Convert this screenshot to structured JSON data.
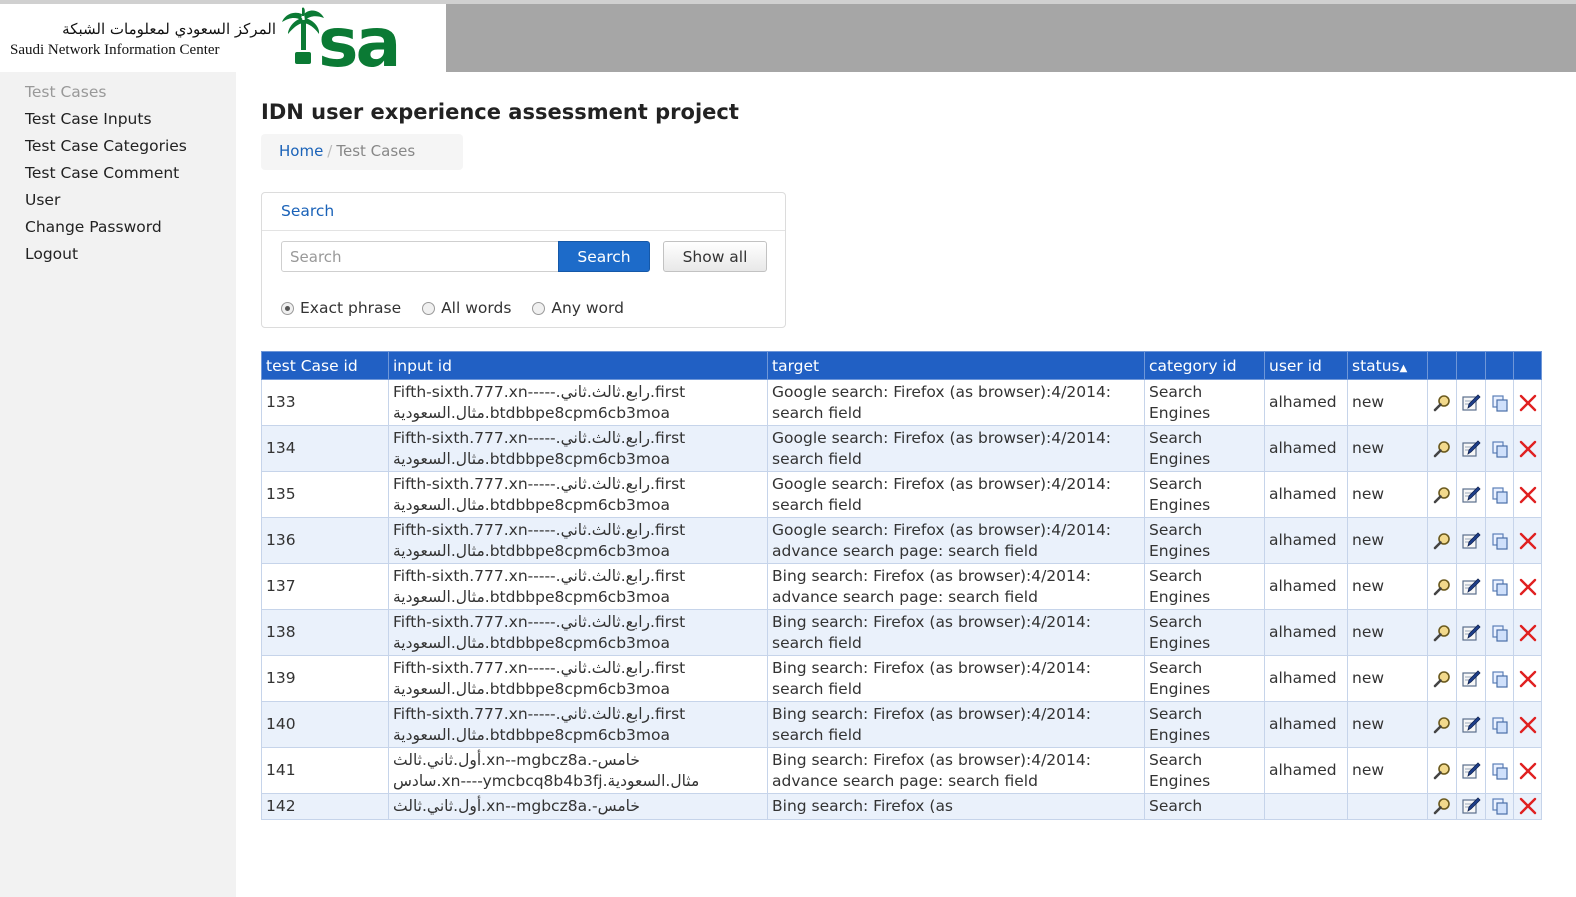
{
  "header": {
    "logo_arabic": "المركز السعودي لمعلومات الشبكة",
    "logo_english": "Saudi Network Information Center",
    "logo_mark": "sa"
  },
  "sidebar": {
    "items": [
      {
        "label": "Test Cases",
        "active": true
      },
      {
        "label": "Test Case Inputs"
      },
      {
        "label": "Test Case Categories"
      },
      {
        "label": "Test Case Comment"
      },
      {
        "label": "User"
      },
      {
        "label": "Change Password"
      },
      {
        "label": "Logout"
      }
    ]
  },
  "main": {
    "title": "IDN user experience assessment project",
    "breadcrumb": {
      "home": "Home",
      "separator": "/",
      "current": "Test Cases"
    },
    "search": {
      "panel_title": "Search",
      "placeholder": "Search",
      "value": "",
      "search_button": "Search",
      "show_all_button": "Show all",
      "options": [
        {
          "label": "Exact phrase",
          "selected": true
        },
        {
          "label": "All words",
          "selected": false
        },
        {
          "label": "Any word",
          "selected": false
        }
      ]
    },
    "table": {
      "columns": [
        "test Case id",
        "input id",
        "target",
        "category id",
        "user id",
        "status"
      ],
      "sort_indicator": "▲",
      "rows": [
        {
          "id": "133",
          "input": "first.رابع.ثالث.ثاني.Fifth-sixth.777.xn-----btdbbpe8cpm6cb3moa.مثال.السعودية",
          "target": "Google search: Firefox (as browser):4/2014: search field",
          "category": "Search Engines",
          "user": "alhamed",
          "status": "new"
        },
        {
          "id": "134",
          "input": "first.رابع.ثالث.ثاني.Fifth-sixth.777.xn-----btdbbpe8cpm6cb3moa.مثال.السعودية",
          "target": "Google search: Firefox (as browser):4/2014: search field",
          "category": "Search Engines",
          "user": "alhamed",
          "status": "new"
        },
        {
          "id": "135",
          "input": "first.رابع.ثالث.ثاني.Fifth-sixth.777.xn-----btdbbpe8cpm6cb3moa.مثال.السعودية",
          "target": "Google search: Firefox (as browser):4/2014: search field",
          "category": "Search Engines",
          "user": "alhamed",
          "status": "new"
        },
        {
          "id": "136",
          "input": "first.رابع.ثالث.ثاني.Fifth-sixth.777.xn-----btdbbpe8cpm6cb3moa.مثال.السعودية",
          "target": "Google search: Firefox (as browser):4/2014: advance search page: search field",
          "category": "Search Engines",
          "user": "alhamed",
          "status": "new"
        },
        {
          "id": "137",
          "input": "first.رابع.ثالث.ثاني.Fifth-sixth.777.xn-----btdbbpe8cpm6cb3moa.مثال.السعودية",
          "target": "Bing search: Firefox (as browser):4/2014: advance search page: search field",
          "category": "Search Engines",
          "user": "alhamed",
          "status": "new"
        },
        {
          "id": "138",
          "input": "first.رابع.ثالث.ثاني.Fifth-sixth.777.xn-----btdbbpe8cpm6cb3moa.مثال.السعودية",
          "target": "Bing search: Firefox (as browser):4/2014: search field",
          "category": "Search Engines",
          "user": "alhamed",
          "status": "new"
        },
        {
          "id": "139",
          "input": "first.رابع.ثالث.ثاني.Fifth-sixth.777.xn-----btdbbpe8cpm6cb3moa.مثال.السعودية",
          "target": "Bing search: Firefox (as browser):4/2014: search field",
          "category": "Search Engines",
          "user": "alhamed",
          "status": "new"
        },
        {
          "id": "140",
          "input": "first.رابع.ثالث.ثاني.Fifth-sixth.777.xn-----btdbbpe8cpm6cb3moa.مثال.السعودية",
          "target": "Bing search: Firefox (as browser):4/2014: search field",
          "category": "Search Engines",
          "user": "alhamed",
          "status": "new"
        },
        {
          "id": "141",
          "input": "خامس-.xn--mgbcz8a.أول.ثاني.ثالث مثال.السعودية.xn----ymcbcq8b4b3fj.سادس",
          "target": "Bing search: Firefox (as browser):4/2014: advance search page: search field",
          "category": "Search Engines",
          "user": "alhamed",
          "status": "new"
        },
        {
          "id": "142",
          "input": "خامس-.xn--mgbcz8a.أول.ثاني.ثالث",
          "target": "Bing search: Firefox (as",
          "category": "Search",
          "user": "",
          "status": ""
        }
      ],
      "row_actions": [
        "view-icon",
        "edit-icon",
        "copy-icon",
        "delete-icon"
      ]
    }
  },
  "colors": {
    "header_bar": "#a6a6a6",
    "table_header": "#2160c4",
    "link": "#1a62b8",
    "button_primary": "#1d6bc9",
    "logo_green": "#0b7a34",
    "delete_red": "#e02020"
  }
}
